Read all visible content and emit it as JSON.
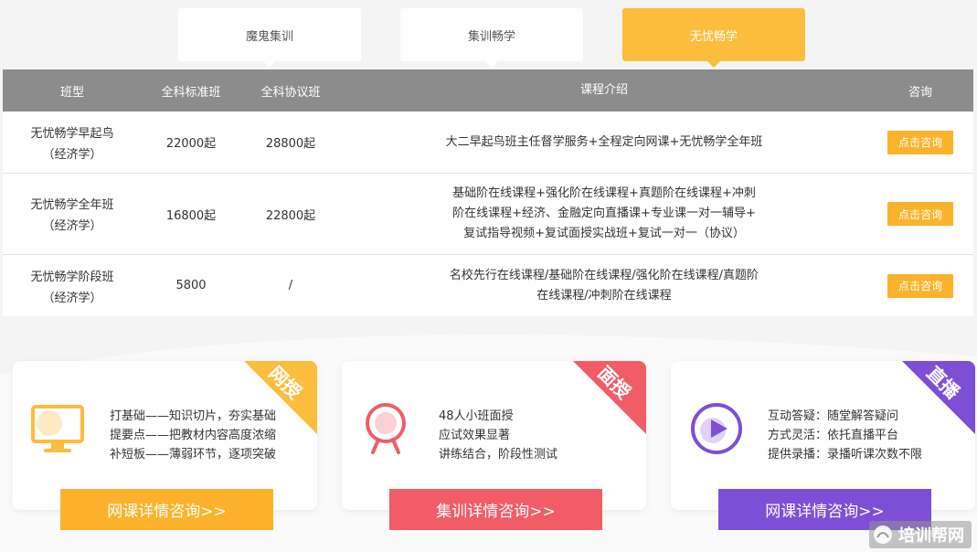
{
  "tabs": [
    {
      "label": "魔鬼集训"
    },
    {
      "label": "集训畅学"
    },
    {
      "label": "无忧畅学"
    }
  ],
  "table": {
    "headers": [
      "班型",
      "全科标准班",
      "全科协议班",
      "课程介绍",
      "咨询"
    ],
    "rows": [
      {
        "name_line1": "无忧畅学早起鸟",
        "name_line2": "（经济学）",
        "standard": "22000起",
        "agreement": "28800起",
        "intro": [
          "大二早起鸟班主任督学服务+全程定向网课+无忧畅学全年班"
        ],
        "button": "点击咨询"
      },
      {
        "name_line1": "无忧畅学全年班",
        "name_line2": "（经济学）",
        "standard": "16800起",
        "agreement": "22800起",
        "intro": [
          "基础阶在线课程+强化阶在线课程+真题阶在线课程+冲刺",
          "阶在线课程+经济、金融定向直播课+专业课一对一辅导+",
          "复试指导视频+复试面授实战班+复试一对一（协议）"
        ],
        "button": "点击咨询"
      },
      {
        "name_line1": "无忧畅学阶段班",
        "name_line2": "（经济学）",
        "standard": "5800",
        "agreement": "/",
        "intro": [
          "名校先行在线课程/基础阶在线课程/强化阶在线课程/真题阶",
          "在线课程/冲刺阶在线课程"
        ],
        "button": "点击咨询"
      }
    ]
  },
  "cards": [
    {
      "ribbon": "网授",
      "ribbon_color": "#fcbd3c",
      "icon": "monitor-icon",
      "lines": [
        "打基础——知识切片，夯实基础",
        "提要点——把教材内容高度浓缩",
        "补短板——薄弱环节，逐项突破"
      ],
      "button": "网课详情咨询>>",
      "button_color": "#fcb22a"
    },
    {
      "ribbon": "面授",
      "ribbon_color": "#f25c67",
      "icon": "person-icon",
      "lines": [
        "48人小班面授",
        "应试效果显著",
        "讲练结合，阶段性测试"
      ],
      "button": "集训详情咨询>>",
      "button_color": "#f25c67"
    },
    {
      "ribbon": "直播",
      "ribbon_color": "#7c4fd6",
      "icon": "play-icon",
      "lines": [
        "互动答疑：随堂解答疑问",
        "方式灵活：依托直播平台",
        "提供录播：录播听课次数不限"
      ],
      "button": "网课详情咨询>>",
      "button_color": "#7c4fd6"
    }
  ],
  "watermark": {
    "text": "培训帮网"
  }
}
